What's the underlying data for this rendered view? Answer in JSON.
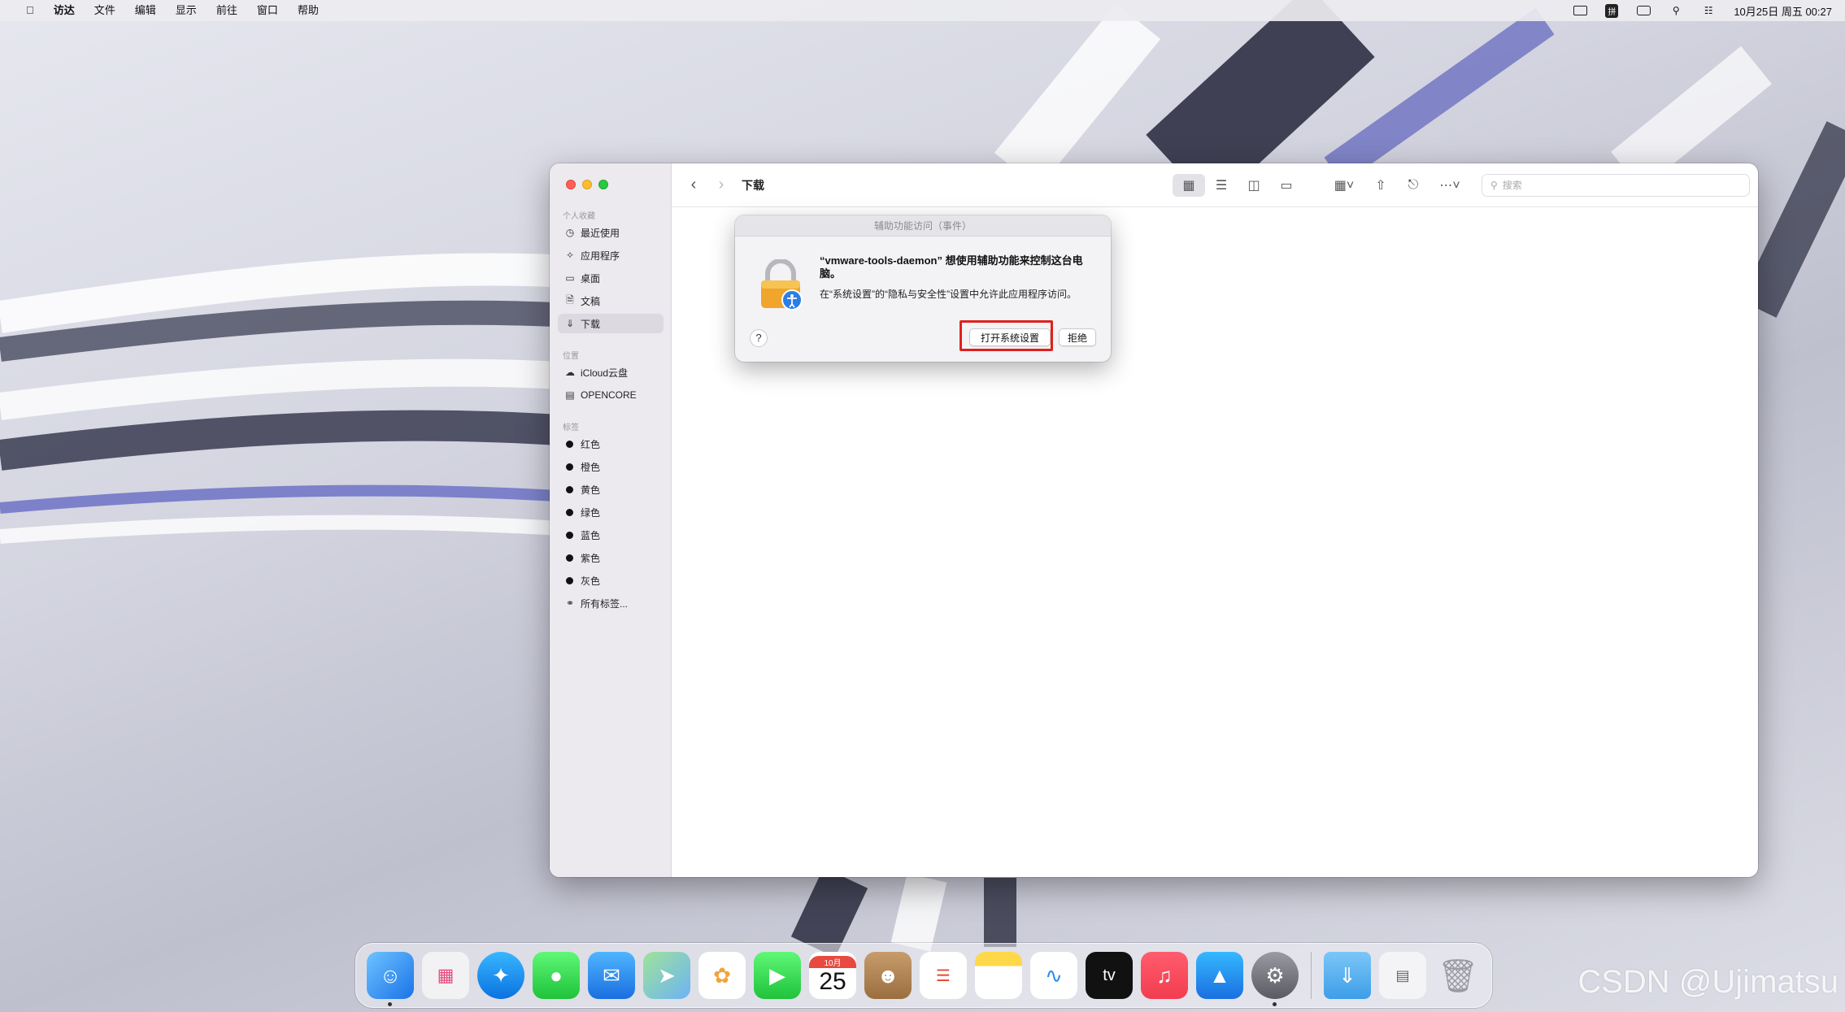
{
  "menubar": {
    "apple_icon": "apple-icon",
    "items": [
      "访达",
      "文件",
      "编辑",
      "显示",
      "前往",
      "窗口",
      "帮助"
    ],
    "input_method": "拼",
    "datetime": "10月25日 周五 00:27"
  },
  "finder": {
    "title": "下载",
    "search_placeholder": "搜索",
    "sidebar": {
      "favorites_label": "个人收藏",
      "favorites": [
        "最近使用",
        "应用程序",
        "桌面",
        "文稿",
        "下载"
      ],
      "locations_label": "位置",
      "locations": [
        "iCloud云盘",
        "OPENCORE"
      ],
      "tags_label": "标签",
      "tags": [
        "红色",
        "橙色",
        "黄色",
        "绿色",
        "蓝色",
        "紫色",
        "灰色"
      ],
      "all_tags": "所有标签..."
    }
  },
  "dialog": {
    "title": "辅助功能访问（事件）",
    "heading": "“vmware-tools-daemon” 想使用辅助功能来控制这台电脑。",
    "body": "在“系统设置”的“隐私与安全性”设置中允许此应用程序访问。",
    "help": "?",
    "open_button": "打开系统设置",
    "deny_button": "拒绝"
  },
  "dock": {
    "calendar_month": "10月",
    "calendar_day": "25",
    "tv_label": "tv"
  },
  "watermark": "CSDN @Ujimatsu",
  "colors": {
    "highlight": "#e0201c",
    "traffic_red": "#ff5f57",
    "traffic_yellow": "#febc2e",
    "traffic_green": "#28c840"
  }
}
